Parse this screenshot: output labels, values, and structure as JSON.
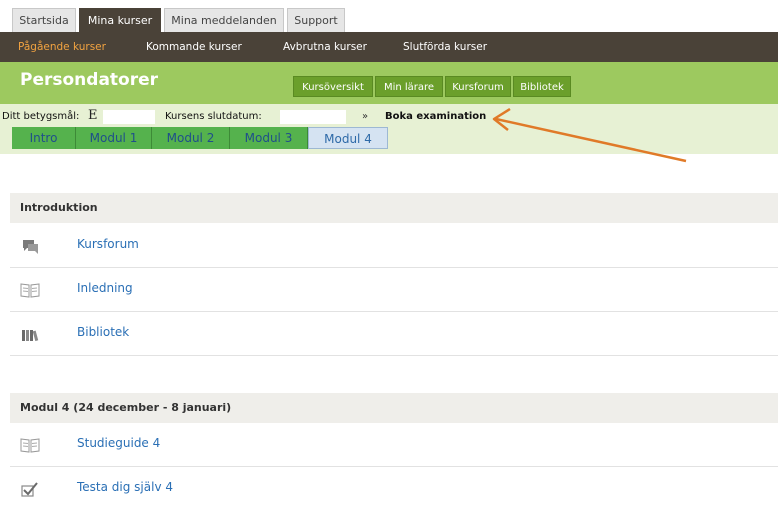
{
  "top_tabs": [
    "Startsida",
    "Mina kurser",
    "Mina meddelanden",
    "Support"
  ],
  "subnav": [
    "Pågående kurser",
    "Kommande kurser",
    "Avbrutna kurser",
    "Slutförda kurser"
  ],
  "course": {
    "title": "Persondatorer",
    "buttons": [
      "Kursöversikt",
      "Min lärare",
      "Kursforum",
      "Bibliotek"
    ]
  },
  "infobar": {
    "grade_label": "Ditt betygsmål:",
    "grade_value": "E",
    "end_date_label": "Kursens slutdatum:",
    "arrow_glyph": "»",
    "book_exam": "Boka examination"
  },
  "module_tabs": [
    "Intro",
    "Modul 1",
    "Modul 2",
    "Modul 3",
    "Modul 4"
  ],
  "sections": [
    {
      "title": "Introduktion",
      "items": [
        "Kursforum",
        "Inledning",
        "Bibliotek"
      ]
    },
    {
      "title": "Modul 4 (24 december - 8 januari)",
      "items": [
        "Studieguide 4",
        "Testa dig själv 4"
      ]
    }
  ],
  "colors": {
    "dark_bar": "#4a4238",
    "accent_orange": "#f2a341",
    "course_green": "#9dc95f",
    "link_blue": "#2a6fb5",
    "annotation_arrow": "#e07a28"
  }
}
